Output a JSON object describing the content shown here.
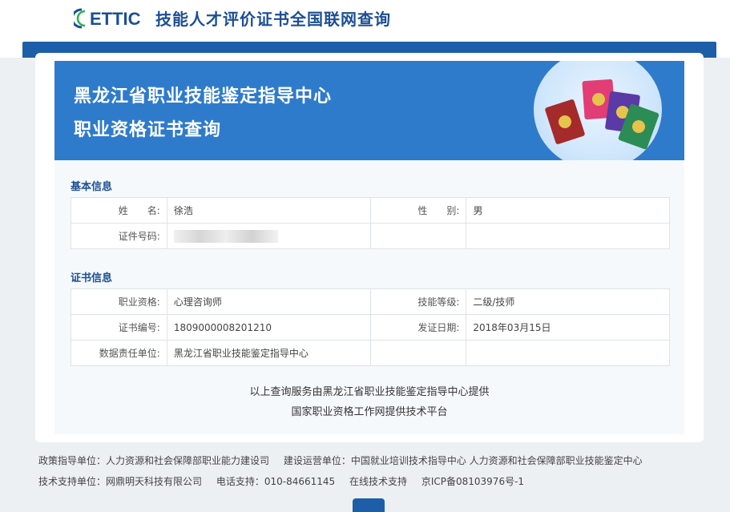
{
  "header": {
    "logo_text": "ETTIC",
    "site_title": "技能人才评价证书全国联网查询"
  },
  "hero": {
    "title1": "黑龙江省职业技能鉴定指导中心",
    "title2": "职业资格证书查询"
  },
  "basic": {
    "section_title": "基本信息",
    "name_label": "姓　　名:",
    "name_value": "徐浩",
    "gender_label": "性　　别:",
    "gender_value": "男",
    "id_label": "证件号码:"
  },
  "cert": {
    "section_title": "证书信息",
    "qual_label": "职业资格:",
    "qual_value": "心理咨询师",
    "level_label": "技能等级:",
    "level_value": "二级/技师",
    "no_label": "证书编号:",
    "no_value": "1809000008201210",
    "date_label": "发证日期:",
    "date_value": "2018年03月15日",
    "org_label": "数据责任单位:",
    "org_value": "黑龙江省职业技能鉴定指导中心"
  },
  "provide": {
    "line1": "以上查询服务由黑龙江省职业技能鉴定指导中心提供",
    "line2": "国家职业资格工作网提供技术平台"
  },
  "footer": {
    "line1_a": "政策指导单位：人力资源和社会保障部职业能力建设司",
    "line1_b": "建设运营单位：中国就业培训技术指导中心 人力资源和社会保障部职业技能鉴定中心",
    "line2_a": "技术支持单位：网鼎明天科技有限公司",
    "line2_b": "电话支持：010-84661145",
    "line2_c": "在线技术支持",
    "line2_d": "京ICP备08103976号-1"
  },
  "colors": {
    "brand_blue": "#1c4f95",
    "hero_blue": "#2f7bcb"
  }
}
